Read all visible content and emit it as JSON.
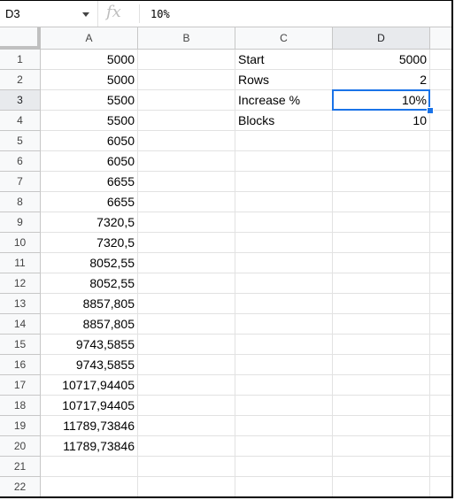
{
  "formula_bar": {
    "name_box": "D3",
    "fx_icon": "function-icon",
    "value": "10%"
  },
  "columns": [
    "A",
    "B",
    "C",
    "D",
    ""
  ],
  "active_column": "D",
  "active_row": 3,
  "selected_cell": "D3",
  "rows": [
    {
      "n": "1",
      "A": "5000",
      "B": "",
      "C": "Start",
      "D": "5000"
    },
    {
      "n": "2",
      "A": "5000",
      "B": "",
      "C": "Rows",
      "D": "2"
    },
    {
      "n": "3",
      "A": "5500",
      "B": "",
      "C": "Increase %",
      "D": "10%"
    },
    {
      "n": "4",
      "A": "5500",
      "B": "",
      "C": "Blocks",
      "D": "10"
    },
    {
      "n": "5",
      "A": "6050",
      "B": "",
      "C": "",
      "D": ""
    },
    {
      "n": "6",
      "A": "6050",
      "B": "",
      "C": "",
      "D": ""
    },
    {
      "n": "7",
      "A": "6655",
      "B": "",
      "C": "",
      "D": ""
    },
    {
      "n": "8",
      "A": "6655",
      "B": "",
      "C": "",
      "D": ""
    },
    {
      "n": "9",
      "A": "7320,5",
      "B": "",
      "C": "",
      "D": ""
    },
    {
      "n": "10",
      "A": "7320,5",
      "B": "",
      "C": "",
      "D": ""
    },
    {
      "n": "11",
      "A": "8052,55",
      "B": "",
      "C": "",
      "D": ""
    },
    {
      "n": "12",
      "A": "8052,55",
      "B": "",
      "C": "",
      "D": ""
    },
    {
      "n": "13",
      "A": "8857,805",
      "B": "",
      "C": "",
      "D": ""
    },
    {
      "n": "14",
      "A": "8857,805",
      "B": "",
      "C": "",
      "D": ""
    },
    {
      "n": "15",
      "A": "9743,5855",
      "B": "",
      "C": "",
      "D": ""
    },
    {
      "n": "16",
      "A": "9743,5855",
      "B": "",
      "C": "",
      "D": ""
    },
    {
      "n": "17",
      "A": "10717,94405",
      "B": "",
      "C": "",
      "D": ""
    },
    {
      "n": "18",
      "A": "10717,94405",
      "B": "",
      "C": "",
      "D": ""
    },
    {
      "n": "19",
      "A": "11789,73846",
      "B": "",
      "C": "",
      "D": ""
    },
    {
      "n": "20",
      "A": "11789,73846",
      "B": "",
      "C": "",
      "D": ""
    },
    {
      "n": "21",
      "A": "",
      "B": "",
      "C": "",
      "D": ""
    },
    {
      "n": "22",
      "A": "",
      "B": "",
      "C": "",
      "D": ""
    }
  ]
}
